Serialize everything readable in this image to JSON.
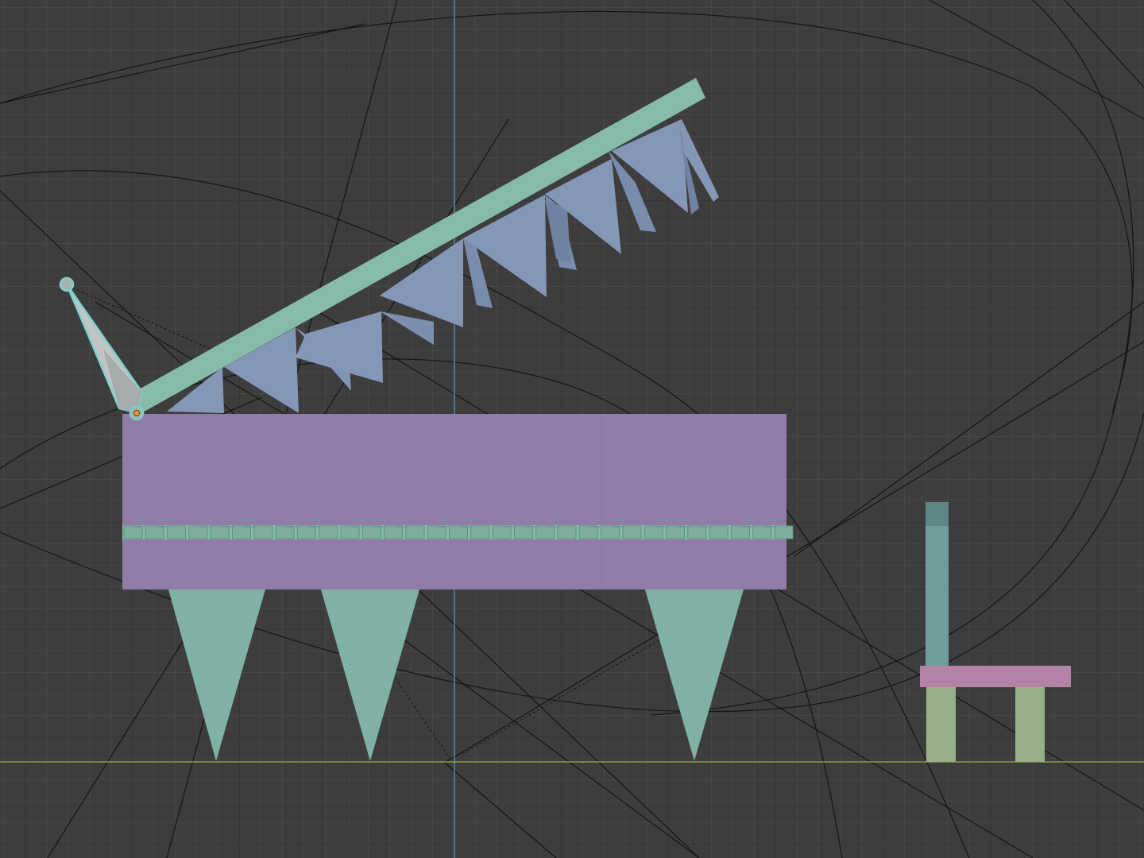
{
  "app": {
    "name": "3D Viewport"
  },
  "viewport": {
    "view": "orthographic-side",
    "background_color": "#3d3d3d",
    "grid": true,
    "axis_colors": {
      "horizontal": "#8d9a3a",
      "vertical": "#4a86b4"
    }
  },
  "objects": [
    {
      "name": "piano-lid",
      "color": "#86bba9",
      "selected": false
    },
    {
      "name": "piano-strings-teeth",
      "color": "#8497b6",
      "selected": false
    },
    {
      "name": "piano-body",
      "color": "#917ba8",
      "selected": false
    },
    {
      "name": "piano-keys",
      "color": "#86bba9",
      "selected": false
    },
    {
      "name": "piano-legs",
      "color": "#7fb2a5",
      "selected": false
    },
    {
      "name": "lid-prop-bone",
      "color": "#c0c4c4",
      "selected": true,
      "outline_color": "#79d4cc"
    },
    {
      "name": "stool-back",
      "color": "#6e9e9c",
      "selected": false
    },
    {
      "name": "stool-seat",
      "color": "#b382a6",
      "selected": false
    },
    {
      "name": "stool-legs",
      "color": "#98b08a",
      "selected": false
    }
  ],
  "origin_marker": {
    "color": "#f0a020"
  },
  "camera_lines": {
    "color": "#141414"
  }
}
